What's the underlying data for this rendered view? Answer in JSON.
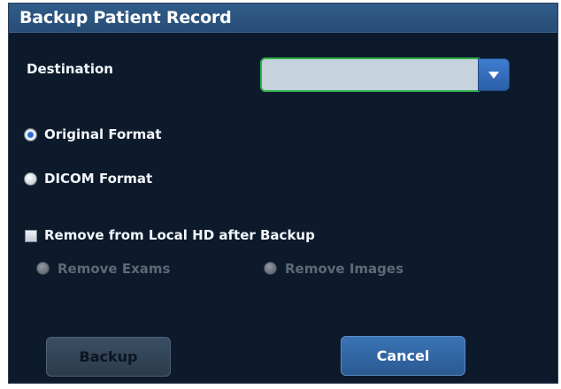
{
  "dialog": {
    "title": "Backup Patient Record"
  },
  "destination": {
    "label": "Destination",
    "value": ""
  },
  "format": {
    "options": [
      {
        "label": "Original Format",
        "selected": true
      },
      {
        "label": "DICOM Format",
        "selected": false
      }
    ]
  },
  "remove": {
    "checkbox_label": "Remove from Local HD after Backup",
    "checked": false,
    "options": [
      {
        "label": "Remove Exams",
        "enabled": false
      },
      {
        "label": "Remove Images",
        "enabled": false
      }
    ]
  },
  "buttons": {
    "backup_label": "Backup",
    "cancel_label": "Cancel"
  },
  "colors": {
    "title_bar": "#2b5580",
    "dialog_bg": "#0d1a2b",
    "combo_border": "#2fb14a",
    "accent_blue": "#2d6ad1"
  }
}
